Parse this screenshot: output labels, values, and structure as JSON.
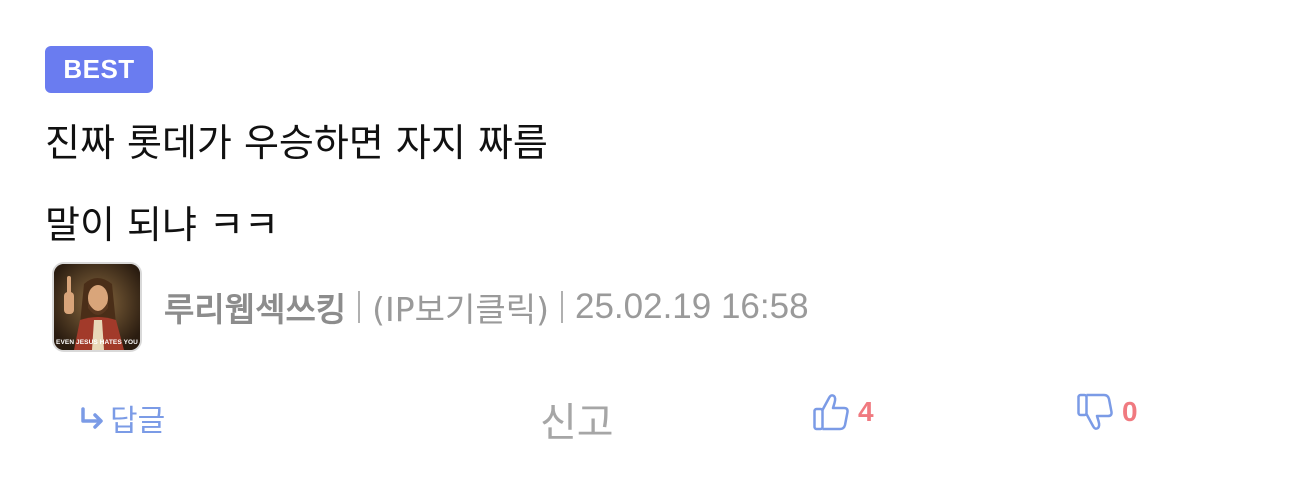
{
  "comment": {
    "badge": "BEST",
    "lines": [
      "진짜 롯데가 우승하면 자지 짜름",
      "말이 되냐 ㅋㅋ"
    ],
    "avatar": {
      "caption": "EVEN JESUS HATES YOU"
    },
    "author": {
      "nickname": "루리웹섹쓰킹",
      "ip_link": "(IP보기클릭)",
      "date": "25.02.19 16:58"
    },
    "actions": {
      "reply_label": "답글",
      "report_label": "신고",
      "like_count": "4",
      "dislike_count": "0"
    },
    "colors": {
      "badge": "#6a7cf0",
      "reply": "#7b9be6",
      "count": "#f07a80",
      "thumb_icon": "#7b9be6"
    },
    "icons": {
      "reply": "reply-arrow-icon",
      "like": "thumbs-up-icon",
      "dislike": "thumbs-down-icon"
    }
  }
}
